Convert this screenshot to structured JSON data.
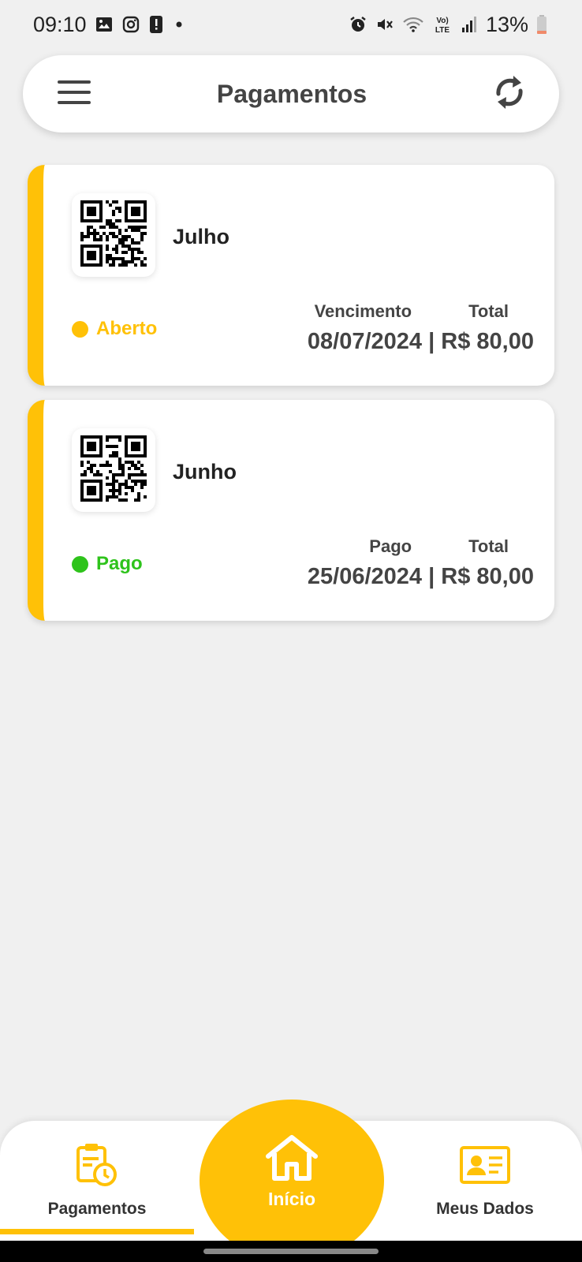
{
  "status_bar": {
    "time": "09:10",
    "battery": "13%",
    "left_icons": [
      "image-icon",
      "instagram-icon",
      "alert-icon",
      "dot-icon"
    ],
    "right_icons": [
      "alarm-icon",
      "mute-icon",
      "wifi-icon",
      "volte-icon",
      "signal-icon",
      "battery-icon"
    ]
  },
  "header": {
    "title": "Pagamentos",
    "menu_icon": "hamburger-menu-icon",
    "refresh_icon": "refresh-icon"
  },
  "payments": [
    {
      "month": "Julho",
      "status": "Aberto",
      "status_color": "#ffc107",
      "date_label": "Vencimento",
      "total_label": "Total",
      "date": "08/07/2024",
      "separator": "|",
      "total": "R$ 80,00"
    },
    {
      "month": "Junho",
      "status": "Pago",
      "status_color": "#2ec31b",
      "date_label": "Pago",
      "total_label": "Total",
      "date": "25/06/2024",
      "separator": "|",
      "total": "R$ 80,00"
    }
  ],
  "bottom_nav": {
    "items": [
      {
        "label": "Pagamentos",
        "icon": "payment-schedule-icon",
        "active": true
      },
      {
        "label": "Início",
        "icon": "home-icon",
        "active": false
      },
      {
        "label": "Meus Dados",
        "icon": "id-card-icon",
        "active": false
      }
    ]
  },
  "colors": {
    "accent": "#ffc107",
    "paid": "#2ec31b",
    "background": "#f0f0f0",
    "text": "#444444"
  }
}
